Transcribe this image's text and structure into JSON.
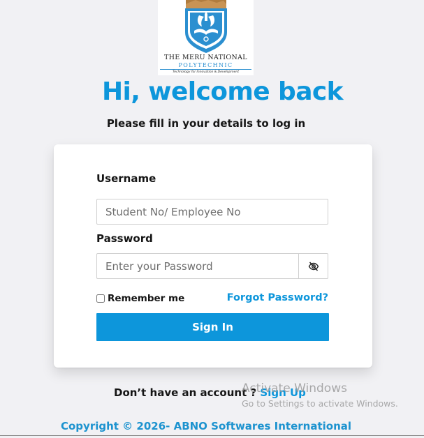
{
  "logo": {
    "name": "THE MERU NATIONAL",
    "subname": "POLYTECHNIC",
    "tagline": "Technology for Innovation & Development"
  },
  "heading": "Hi, welcome back",
  "subheading": "Please fill in your details to log in",
  "form": {
    "username_label": "Username",
    "username_placeholder": "Student No/ Employee No",
    "password_label": "Password",
    "password_placeholder": "Enter your Password",
    "remember_label": "Remember me",
    "forgot_label": "Forgot Password?",
    "signin_label": "Sign In"
  },
  "signup": {
    "prompt": "Don’t have an account ? ",
    "link": "Sign Up"
  },
  "copyright": "Copyright © 2026- ABNO Softwares International",
  "watermark": {
    "title": "Activate Windows",
    "subtitle": "Go to Settings to activate Windows."
  },
  "colors": {
    "accent": "#0d96db",
    "background": "#f1f1f4",
    "card": "#ffffff"
  }
}
